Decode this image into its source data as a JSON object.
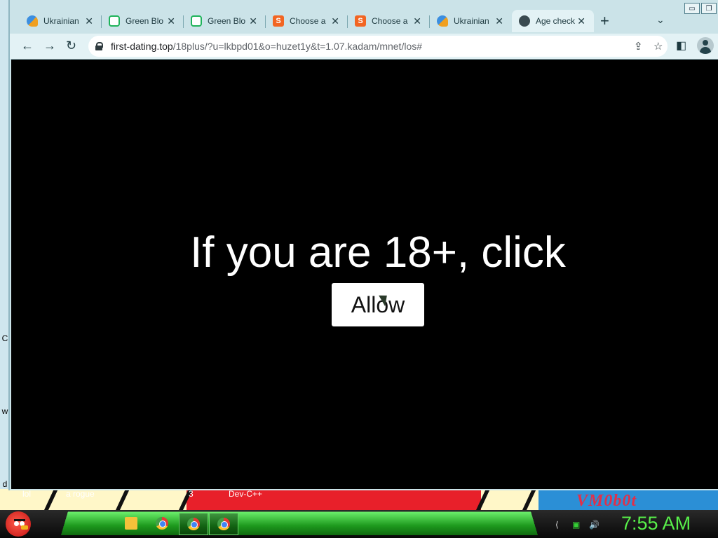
{
  "window": {
    "restore_glyph": "❐",
    "minimize_glyph": "▭"
  },
  "tabs": [
    {
      "title": "Ukrainian",
      "icon": "ukrainian-site-icon",
      "active": false
    },
    {
      "title": "Green Blo",
      "icon": "green-block-icon",
      "active": false
    },
    {
      "title": "Green Blo",
      "icon": "green-block-icon",
      "active": false
    },
    {
      "title": "Choose a",
      "icon": "s-logo-icon",
      "active": false
    },
    {
      "title": "Choose a",
      "icon": "s-logo-icon",
      "active": false
    },
    {
      "title": "Ukrainian",
      "icon": "ukrainian-site-icon",
      "active": false
    },
    {
      "title": "Age check",
      "icon": "globe-icon",
      "active": true
    }
  ],
  "tab_close_glyph": "✕",
  "new_tab_glyph": "+",
  "tab_menu_glyph": "⌄",
  "toolbar": {
    "back_glyph": "←",
    "forward_glyph": "→",
    "reload_glyph": "↻",
    "url_host": "first-dating.top",
    "url_path": "/18plus/?u=lkbpd01&o=huzet1y&t=1.07.kadam/mnet/los#",
    "share_glyph": "⇪",
    "bookmark_glyph": "☆",
    "sidepanel_glyph": "◧"
  },
  "page": {
    "headline": "If you are 18+, click",
    "allow_label": "Allow"
  },
  "desktop": {
    "left_letters": [
      "C",
      "w",
      "d"
    ],
    "strip_labels": [
      "lol",
      "a rogue",
      "3",
      "Dev-C++"
    ],
    "logo_text": "VM0b0t"
  },
  "taskbar": {
    "tray_glyphs": [
      "⟨",
      "▣",
      "🔊"
    ],
    "clock": "7:55 AM"
  },
  "colors": {
    "accent_green": "#58f04a",
    "page_background": "#000000",
    "chrome_frame": "#cbe3e8"
  }
}
